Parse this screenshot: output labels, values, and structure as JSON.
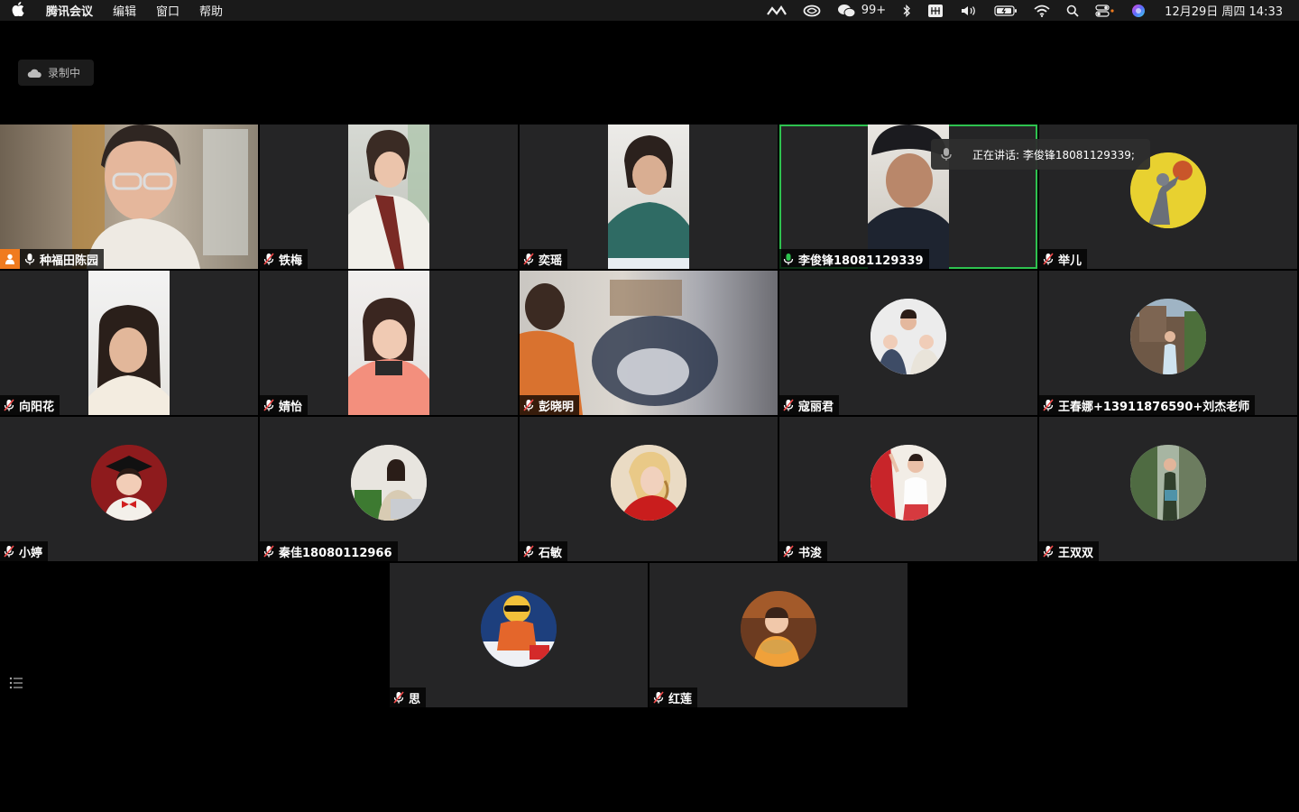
{
  "menubar": {
    "app_name": "腾讯会议",
    "menus": [
      "编辑",
      "窗口",
      "帮助"
    ],
    "wechat_badge": "99+",
    "clock": "12月29日 周四  14:33"
  },
  "recording": {
    "label": "录制中"
  },
  "speaking": {
    "text": "正在讲话: 李俊锋18081129339;"
  },
  "participants": [
    {
      "name": "种福田陈园",
      "host": true
    },
    {
      "name": "铁梅"
    },
    {
      "name": "奕瑶"
    },
    {
      "name": "李俊锋18081129339",
      "active": true
    },
    {
      "name": "举儿"
    },
    {
      "name": "向阳花"
    },
    {
      "name": "婧怡"
    },
    {
      "name": "彭晓明"
    },
    {
      "name": "寇丽君"
    },
    {
      "name": "王春娜+13911876590+刘杰老师"
    },
    {
      "name": "小婷"
    },
    {
      "name": "秦佳18080112966"
    },
    {
      "name": "石敏"
    },
    {
      "name": "书浚"
    },
    {
      "name": "王双双"
    },
    {
      "name": "思"
    },
    {
      "name": "红莲"
    }
  ],
  "colors": {
    "active_border": "#2ec24f",
    "host_badge": "#f07b1f",
    "tile_bg": "#252526"
  }
}
